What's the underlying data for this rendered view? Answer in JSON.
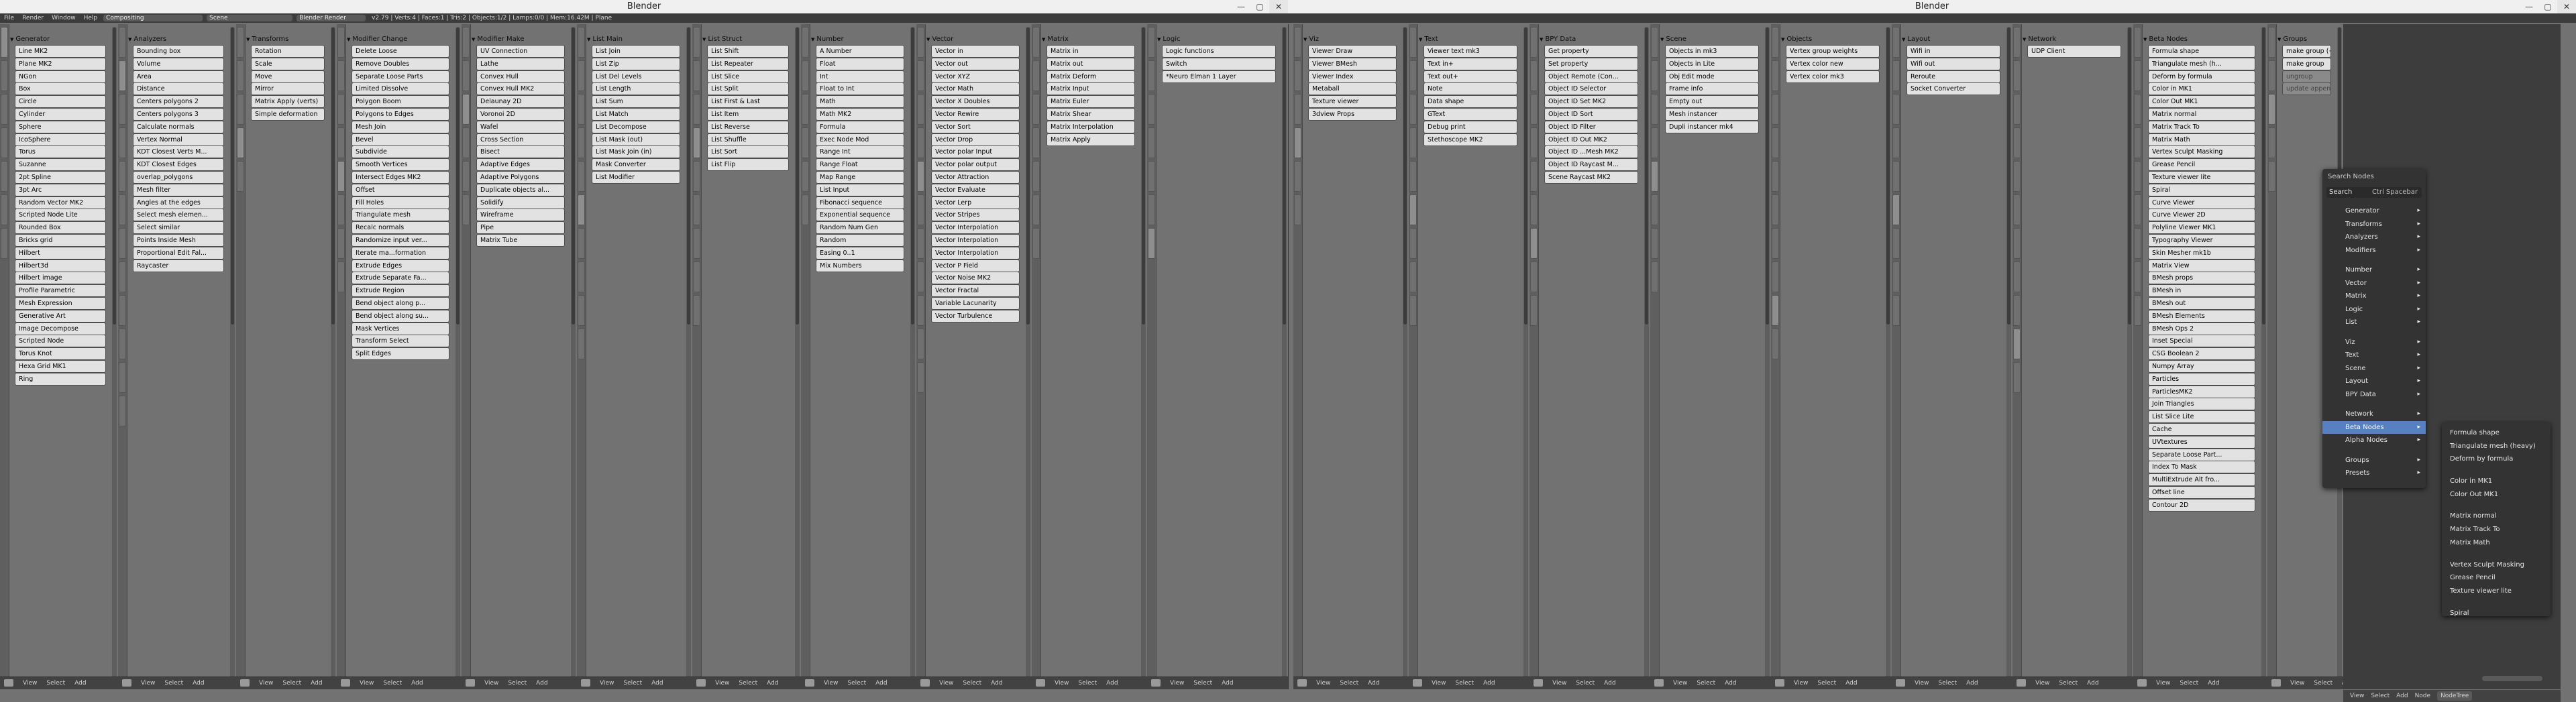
{
  "app": {
    "title_left": "Blender",
    "title_right": "Blender",
    "menus": [
      "File",
      "Render",
      "Window",
      "Help"
    ],
    "layout": "Compositing",
    "scene": "Scene",
    "engine": "Blender Render",
    "stats": "v2.79 | Verts:4 | Faces:1 | Tris:2 | Objects:1/2 | Lamps:0/0 | Mem:16.42M | Plane",
    "window_controls": [
      "—",
      "▢",
      "✕"
    ]
  },
  "panels": [
    {
      "title": "Generator",
      "items": [
        "Line MK2",
        "Plane MK2",
        "NGon",
        "Box",
        "Circle",
        "Cylinder",
        "Sphere",
        "IcoSphere",
        "Torus",
        "Suzanne",
        "2pt Spline",
        "3pt Arc",
        "Random Vector MK2",
        "Scripted Node Lite",
        "Rounded Box",
        "Bricks grid",
        "Hilbert",
        "Hilbert3d",
        "Hilbert image",
        "Profile Parametric",
        "Mesh Expression",
        "Generative Art",
        "Image Decompose",
        "Scripted Node",
        "Torus Knot",
        "Hexa Grid MK1",
        "Ring"
      ]
    },
    {
      "title": "Analyzers",
      "items": [
        "Bounding box",
        "Volume",
        "Area",
        "Distance",
        "Centers polygons 2",
        "Centers polygons 3",
        "Calculate normals",
        "Vertex Normal",
        "KDT Closest Verts M...",
        "KDT Closest Edges",
        "overlap_polygons",
        "Mesh filter",
        "Angles at the edges",
        "Select mesh elemen...",
        "Select similar",
        "Points Inside Mesh",
        "Proportional Edit Fal...",
        "Raycaster"
      ]
    },
    {
      "title": "Transforms",
      "items": [
        "Rotation",
        "Scale",
        "Move",
        "Mirror",
        "Matrix Apply (verts)",
        "Simple deformation"
      ]
    },
    {
      "title": "Modifier Change",
      "items": [
        "Delete Loose",
        "Remove Doubles",
        "Separate Loose Parts",
        "Limited Dissolve",
        "Polygon Boom",
        "Polygons to Edges",
        "Mesh Join",
        "Bevel",
        "Subdivide",
        "Smooth Vertices",
        "Intersect Edges MK2",
        "Offset",
        "Fill Holes",
        "Triangulate mesh",
        "Recalc normals",
        "Randomize input ver...",
        "Iterate ma...formation",
        "Extrude Edges",
        "Extrude Separate Fa...",
        "Extrude Region",
        "Bend object along p...",
        "Bend object along su...",
        "Mask Vertices",
        "Transform Select",
        "Split Edges"
      ]
    },
    {
      "title": "Modifier Make",
      "items": [
        "UV Connection",
        "Lathe",
        "Convex Hull",
        "Convex Hull MK2",
        "Delaunay 2D",
        "Voronoi 2D",
        "Wafel",
        "Cross Section",
        "Bisect",
        "Adaptive Edges",
        "Adaptive Polygons",
        "Duplicate objects al...",
        "Solidify",
        "Wireframe",
        "Pipe",
        "Matrix Tube"
      ]
    },
    {
      "title": "List Main",
      "items": [
        "List Join",
        "List Zip",
        "List Del Levels",
        "List Length",
        "List Sum",
        "List Match",
        "List Decompose",
        "List Mask (out)",
        "List Mask Join (in)",
        "Mask Converter",
        "List Modifier"
      ]
    },
    {
      "title": "List Struct",
      "items": [
        "List Shift",
        "List Repeater",
        "List Slice",
        "List Split",
        "List First & Last",
        "List Item",
        "List Reverse",
        "List Shuffle",
        "List Sort",
        "List Flip"
      ]
    },
    {
      "title": "Number",
      "items": [
        "A Number",
        "Float",
        "Int",
        "Float to Int",
        "Math",
        "Math MK2",
        "Formula",
        "Exec Node Mod",
        "Range Int",
        "Range Float",
        "Map Range",
        "List Input",
        "Fibonacci sequence",
        "Exponential sequence",
        "Random Num Gen",
        "Random",
        "Easing 0..1",
        "Mix Numbers"
      ]
    },
    {
      "title": "Vector",
      "items": [
        "Vector in",
        "Vector out",
        "Vector XYZ",
        "Vector Math",
        "Vector X Doubles",
        "Vector Rewire",
        "Vector Sort",
        "Vector Drop",
        "Vector polar Input",
        "Vector polar output",
        "Vector Attraction",
        "Vector Evaluate",
        "Vector Lerp",
        "Vector Stripes",
        "Vector Interpolation",
        "Vector Interpolation",
        "Vector Interpolation",
        "Vector P Field",
        "Vector Noise MK2",
        "Vector Fractal",
        "Variable Lacunarity",
        "Vector Turbulence"
      ]
    },
    {
      "title": "Matrix",
      "items": [
        "Matrix in",
        "Matrix out",
        "Matrix Deform",
        "Matrix Input",
        "Matrix Euler",
        "Matrix Shear",
        "Matrix Interpolation",
        "Matrix Apply"
      ]
    },
    {
      "title": "Logic",
      "items": [
        "Logic functions",
        "Switch",
        "*Neuro Elman 1 Layer"
      ]
    },
    {
      "title": "Viz",
      "items": [
        "Viewer Draw",
        "Viewer BMesh",
        "Viewer Index",
        "Metaball",
        "Texture viewer",
        "3dview Props"
      ]
    },
    {
      "title": "Text",
      "items": [
        "Viewer text mk3",
        "Text in+",
        "Text out+",
        "Note",
        "Data shape",
        "GText",
        "Debug print",
        "Stethoscope MK2"
      ]
    },
    {
      "title": "BPY Data",
      "items": [
        "Get property",
        "Set property",
        "Object Remote (Con...",
        "Object ID Selector",
        "Object ID Set MK2",
        "Object ID Sort",
        "Object ID Filter",
        "Object ID Out MK2",
        "Object ID ...Mesh MK2",
        "Object ID Raycast M...",
        "Scene Raycast MK2"
      ]
    },
    {
      "title": "Scene",
      "items": [
        "Objects in mk3",
        "Objects in Lite",
        "Obj Edit mode",
        "Frame info",
        "Empty out",
        "Mesh instancer",
        "Dupli instancer mk4"
      ]
    },
    {
      "title": "Objects",
      "items": [
        "Vertex group weights",
        "Vertex color new",
        "Vertex color mk3"
      ]
    },
    {
      "title": "Layout",
      "items": [
        "Wifi in",
        "Wifi out",
        "Reroute",
        "Socket Converter"
      ]
    },
    {
      "title": "Network",
      "items": [
        "UDP Client"
      ]
    },
    {
      "title": "Beta Nodes",
      "items": [
        "Formula shape",
        "Triangulate mesh (h...",
        "Deform by formula",
        "Color in MK1",
        "Color Out MK1",
        "Matrix normal",
        "Matrix Track To",
        "Matrix Math",
        "Vertex Sculpt Masking",
        "Grease Pencil",
        "Texture viewer lite",
        "Spiral",
        "Curve Viewer",
        "Curve Viewer 2D",
        "Polyline Viewer MK1",
        "Typography Viewer",
        "Skin Mesher mk1b",
        "Matrix View",
        "BMesh props",
        "BMesh in",
        "BMesh out",
        "BMesh Elements",
        "BMesh Ops 2",
        "Inset Special",
        "CSG Boolean 2",
        "Numpy Array",
        "Particles",
        "ParticlesMK2",
        "Join Triangles",
        "List Slice Lite",
        "Cache",
        "UVtextures",
        "Separate Loose Part...",
        "Index To Mask",
        "MultiExtrude Alt fro...",
        "Offset line",
        "Contour 2D"
      ]
    },
    {
      "title": "Groups",
      "items": [
        "make group (+rel...",
        "make group",
        "ungroup",
        "update appended..."
      ]
    }
  ],
  "editor_header": {
    "items": [
      "View",
      "Select",
      "Add"
    ]
  },
  "search_menu": {
    "title": "Search Nodes",
    "search_label": "Search",
    "search_shortcut": "Ctrl Spacebar",
    "groups": [
      [
        "Generator",
        "Transforms",
        "Analyzers",
        "Modifiers"
      ],
      [
        "Number",
        "Vector",
        "Matrix",
        "Logic",
        "List"
      ],
      [
        "Viz",
        "Text",
        "Scene",
        "Layout",
        "BPY Data"
      ],
      [
        "Network",
        "Beta Nodes",
        "Alpha Nodes"
      ],
      [
        "Groups",
        "Presets"
      ]
    ],
    "selected": "Beta Nodes"
  },
  "submenu": {
    "groups": [
      [
        "Formula shape",
        "Triangulate mesh (heavy)",
        "Deform by formula"
      ],
      [
        "Color in MK1",
        "Color Out MK1"
      ],
      [
        "Matrix normal",
        "Matrix Track To",
        "Matrix Math"
      ],
      [
        "Vertex Sculpt Masking",
        "Grease Pencil",
        "Texture viewer lite"
      ],
      [
        "Spiral"
      ]
    ]
  },
  "node_header": {
    "items": [
      "View",
      "Select",
      "Add",
      "Node"
    ],
    "tree": "NodeTree"
  }
}
